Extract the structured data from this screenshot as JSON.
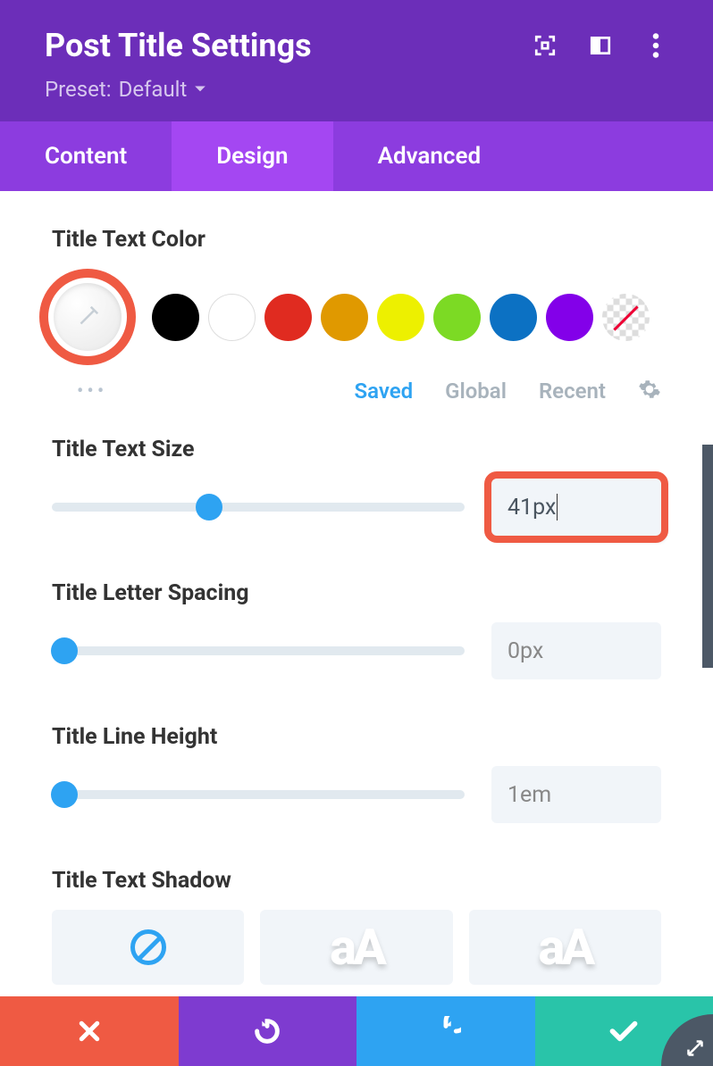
{
  "header": {
    "title": "Post Title Settings",
    "preset_label": "Preset:",
    "preset_value": "Default"
  },
  "tabs": {
    "content": "Content",
    "design": "Design",
    "advanced": "Advanced"
  },
  "sections": {
    "text_color": {
      "label": "Title Text Color",
      "swatches": [
        "#000000",
        "#ffffff",
        "#e02b20",
        "#e09900",
        "#edf000",
        "#7cda24",
        "#0c71c3",
        "#8300e9"
      ],
      "meta": {
        "saved": "Saved",
        "global": "Global",
        "recent": "Recent"
      }
    },
    "text_size": {
      "label": "Title Text Size",
      "value": "41px",
      "slider_pct": 38
    },
    "letter_spacing": {
      "label": "Title Letter Spacing",
      "value": "0px",
      "slider_pct": 3
    },
    "line_height": {
      "label": "Title Line Height",
      "value": "1em",
      "slider_pct": 3
    },
    "text_shadow": {
      "label": "Title Text Shadow",
      "sample": "aA"
    }
  }
}
